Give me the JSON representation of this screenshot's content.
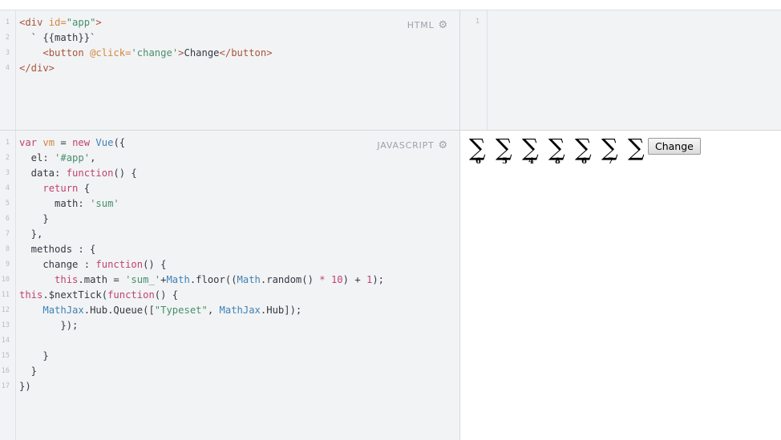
{
  "panels": {
    "html_label": "HTML",
    "js_label": "JAVASCRIPT"
  },
  "html_code": {
    "line_numbers": [
      "1",
      "2",
      "3",
      "4"
    ]
  },
  "css_pane": {
    "line_number": "1"
  },
  "js_code": {
    "line_numbers": [
      "1",
      "2",
      "3",
      "4",
      "5",
      "6",
      "7",
      "8",
      "9",
      "10",
      "11",
      "12",
      "13",
      "14",
      "15",
      "16",
      "17"
    ]
  },
  "output": {
    "sum_subscripts": [
      "6",
      "5",
      "4",
      "8",
      "6",
      "7",
      ""
    ],
    "sum_symbol": "∑",
    "button_label": "Change"
  }
}
